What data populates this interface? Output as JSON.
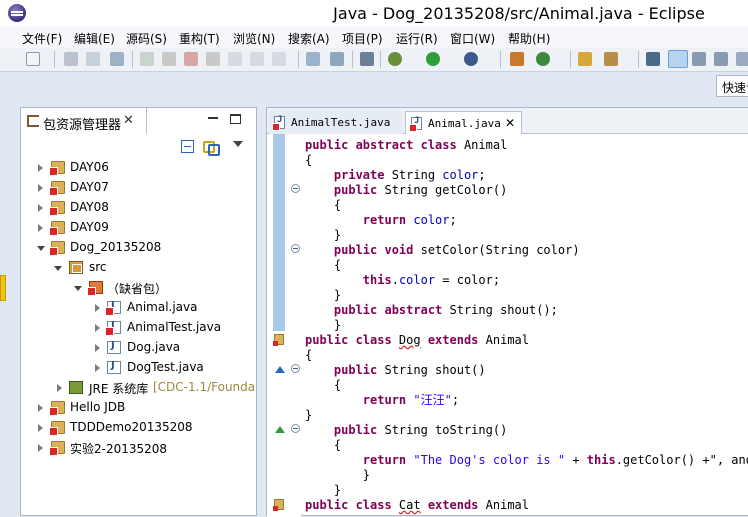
{
  "window": {
    "title": "Java  -  Dog_20135208/src/Animal.java  -  Eclipse"
  },
  "menu": [
    "文件(F)",
    "编辑(E)",
    "源码(S)",
    "重构(T)",
    "浏览(N)",
    "搜索(A)",
    "项目(P)",
    "运行(R)",
    "窗口(W)",
    "帮助(H)"
  ],
  "quick_access": {
    "label": "快速访问"
  },
  "explorer": {
    "title": "包资源管理器",
    "close": "✕",
    "tree": [
      {
        "label": "DAY06",
        "extra": ""
      },
      {
        "label": "DAY07",
        "extra": ""
      },
      {
        "label": "DAY08",
        "extra": ""
      },
      {
        "label": "DAY09",
        "extra": ""
      },
      {
        "label": "Dog_20135208",
        "extra": ""
      },
      {
        "label": "src",
        "extra": ""
      },
      {
        "label": "（缺省包）",
        "extra": ""
      },
      {
        "label": "Animal.java",
        "extra": ""
      },
      {
        "label": "AnimalTest.java",
        "extra": ""
      },
      {
        "label": "Dog.java",
        "extra": ""
      },
      {
        "label": "DogTest.java",
        "extra": ""
      },
      {
        "label": "JRE 系统库",
        "extra": "[CDC-1.1/Founda"
      },
      {
        "label": "Hello JDB",
        "extra": ""
      },
      {
        "label": "TDDDemo20135208",
        "extra": ""
      },
      {
        "label": "实验2-20135208",
        "extra": ""
      }
    ]
  },
  "editor": {
    "tabs": [
      {
        "label": "AnimalTest.java",
        "active": false
      },
      {
        "label": "Animal.java",
        "active": true,
        "close": "✕"
      }
    ],
    "lines": [
      [
        [
          "k",
          "public abstract class "
        ],
        [
          "",
          "Animal"
        ]
      ],
      [
        [
          "",
          "{"
        ]
      ],
      [
        [
          "",
          "    "
        ],
        [
          "k",
          "private "
        ],
        [
          "",
          "String "
        ],
        [
          "f",
          "color"
        ],
        [
          "",
          ";"
        ]
      ],
      [
        [
          "",
          "    "
        ],
        [
          "k",
          "public "
        ],
        [
          "",
          "String getColor()"
        ]
      ],
      [
        [
          "",
          "    {"
        ]
      ],
      [
        [
          "",
          "        "
        ],
        [
          "k",
          "return "
        ],
        [
          "f",
          "color"
        ],
        [
          "",
          ";"
        ]
      ],
      [
        [
          "",
          "    }"
        ]
      ],
      [
        [
          "",
          "    "
        ],
        [
          "k",
          "public void "
        ],
        [
          "",
          "setColor(String color)"
        ]
      ],
      [
        [
          "",
          "    {"
        ]
      ],
      [
        [
          "",
          "        "
        ],
        [
          "k",
          "this"
        ],
        [
          "",
          "."
        ],
        [
          "f",
          "color"
        ],
        [
          "",
          " = color;"
        ]
      ],
      [
        [
          "",
          "    }"
        ]
      ],
      [
        [
          "",
          "    "
        ],
        [
          "k",
          "public abstract "
        ],
        [
          "",
          "String shout();"
        ]
      ],
      [
        [
          "",
          "    }"
        ]
      ],
      [
        [
          "k",
          "public class "
        ],
        [
          "sq",
          "Dog"
        ],
        [
          "k",
          " extends "
        ],
        [
          "",
          "Animal"
        ]
      ],
      [
        [
          "",
          "{"
        ]
      ],
      [
        [
          "",
          "    "
        ],
        [
          "k",
          "public "
        ],
        [
          "",
          "String shout()"
        ]
      ],
      [
        [
          "",
          "    {"
        ]
      ],
      [
        [
          "",
          "        "
        ],
        [
          "k",
          "return "
        ],
        [
          "s",
          "\"汪汪\""
        ],
        [
          "",
          ";"
        ]
      ],
      [
        [
          "",
          "}"
        ]
      ],
      [
        [
          "",
          "    "
        ],
        [
          "k",
          "public "
        ],
        [
          "",
          "String toString()"
        ]
      ],
      [
        [
          "",
          "    {"
        ]
      ],
      [
        [
          "",
          "        "
        ],
        [
          "k",
          "return "
        ],
        [
          "s",
          "\"The Dog's color is \""
        ],
        [
          "",
          " + "
        ],
        [
          "k",
          "this"
        ],
        [
          "",
          ".getColor() +\", and i"
        ]
      ],
      [
        [
          "",
          "        }"
        ]
      ],
      [
        [
          "",
          "    }"
        ]
      ],
      [
        [
          "k",
          "public class "
        ],
        [
          "sq",
          "Cat"
        ],
        [
          "k",
          " extends "
        ],
        [
          "",
          "Animal"
        ]
      ]
    ]
  }
}
